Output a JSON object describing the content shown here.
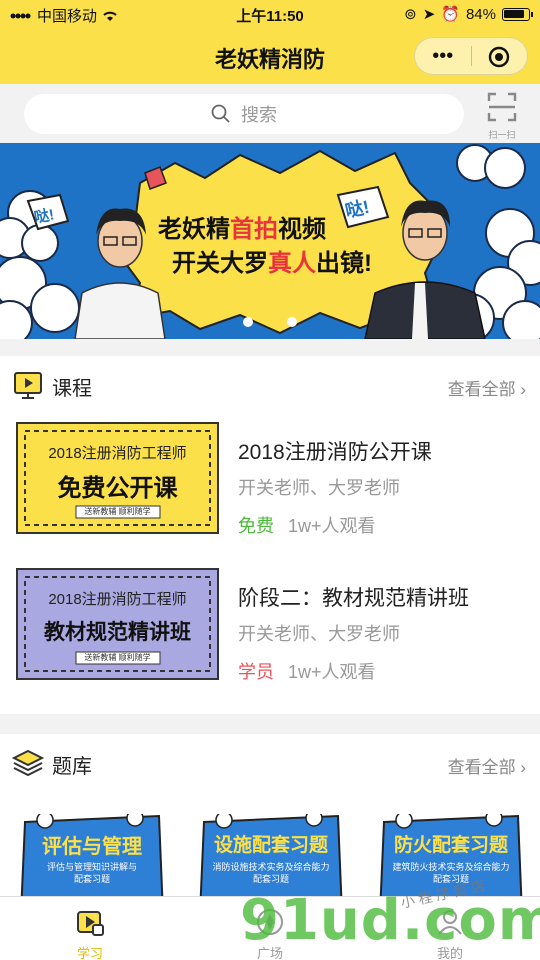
{
  "status_bar": {
    "carrier": "中国移动",
    "time": "上午11:50",
    "battery": "84%"
  },
  "nav": {
    "title": "老妖精消防",
    "more_icon": "more-dots-icon",
    "close_icon": "target-icon"
  },
  "search": {
    "placeholder": "搜索",
    "scan_label": "扫一扫"
  },
  "banner": {
    "line1_a": "老妖精",
    "line1_b": "首拍",
    "line1_c": "视频",
    "line2_a": "开关大罗",
    "line2_b": "真人",
    "line2_c": "出镜!",
    "badge": "哒!",
    "dots": 3,
    "active_dot": 1
  },
  "courses_section": {
    "title": "课程",
    "more": "查看全部",
    "items": [
      {
        "thumb_year": "2018注册消防工程师",
        "thumb_main": "免费公开课",
        "thumb_sub": "送新教辅 顺利随学",
        "title": "2018注册消防公开课",
        "teacher": "开关老师、大罗老师",
        "price": "免费",
        "views": "1w+人观看"
      },
      {
        "thumb_year": "2018注册消防工程师",
        "thumb_main": "教材规范精讲班",
        "thumb_sub": "送新教辅 顺利随学",
        "title": "阶段二：教材规范精讲班",
        "teacher": "开关老师、大罗老师",
        "price": "学员",
        "views": "1w+人观看"
      }
    ]
  },
  "bank_section": {
    "title": "题库",
    "more": "查看全部",
    "items": [
      {
        "title": "评估与管理",
        "sub": "评估与管理知识讲解与",
        "sub2": "配套习题"
      },
      {
        "title": "设施配套习题",
        "sub": "消防设施技术实务及综合能力",
        "sub2": "配套习题"
      },
      {
        "title": "防火配套习题",
        "sub": "建筑防火技术实务及综合能力",
        "sub2": "配套习题"
      }
    ]
  },
  "tabs": [
    {
      "label": "学习",
      "icon": "study-icon"
    },
    {
      "label": "广场",
      "icon": "plaza-icon"
    },
    {
      "label": "我的",
      "icon": "profile-icon"
    }
  ],
  "watermark": {
    "text": "91ud.com",
    "side": "小 程 序 商 店"
  },
  "colors": {
    "brand_yellow": "#fbe04a",
    "banner_blue": "#1f73c6",
    "free_green": "#4cba3b",
    "member_red": "#e8545b"
  }
}
